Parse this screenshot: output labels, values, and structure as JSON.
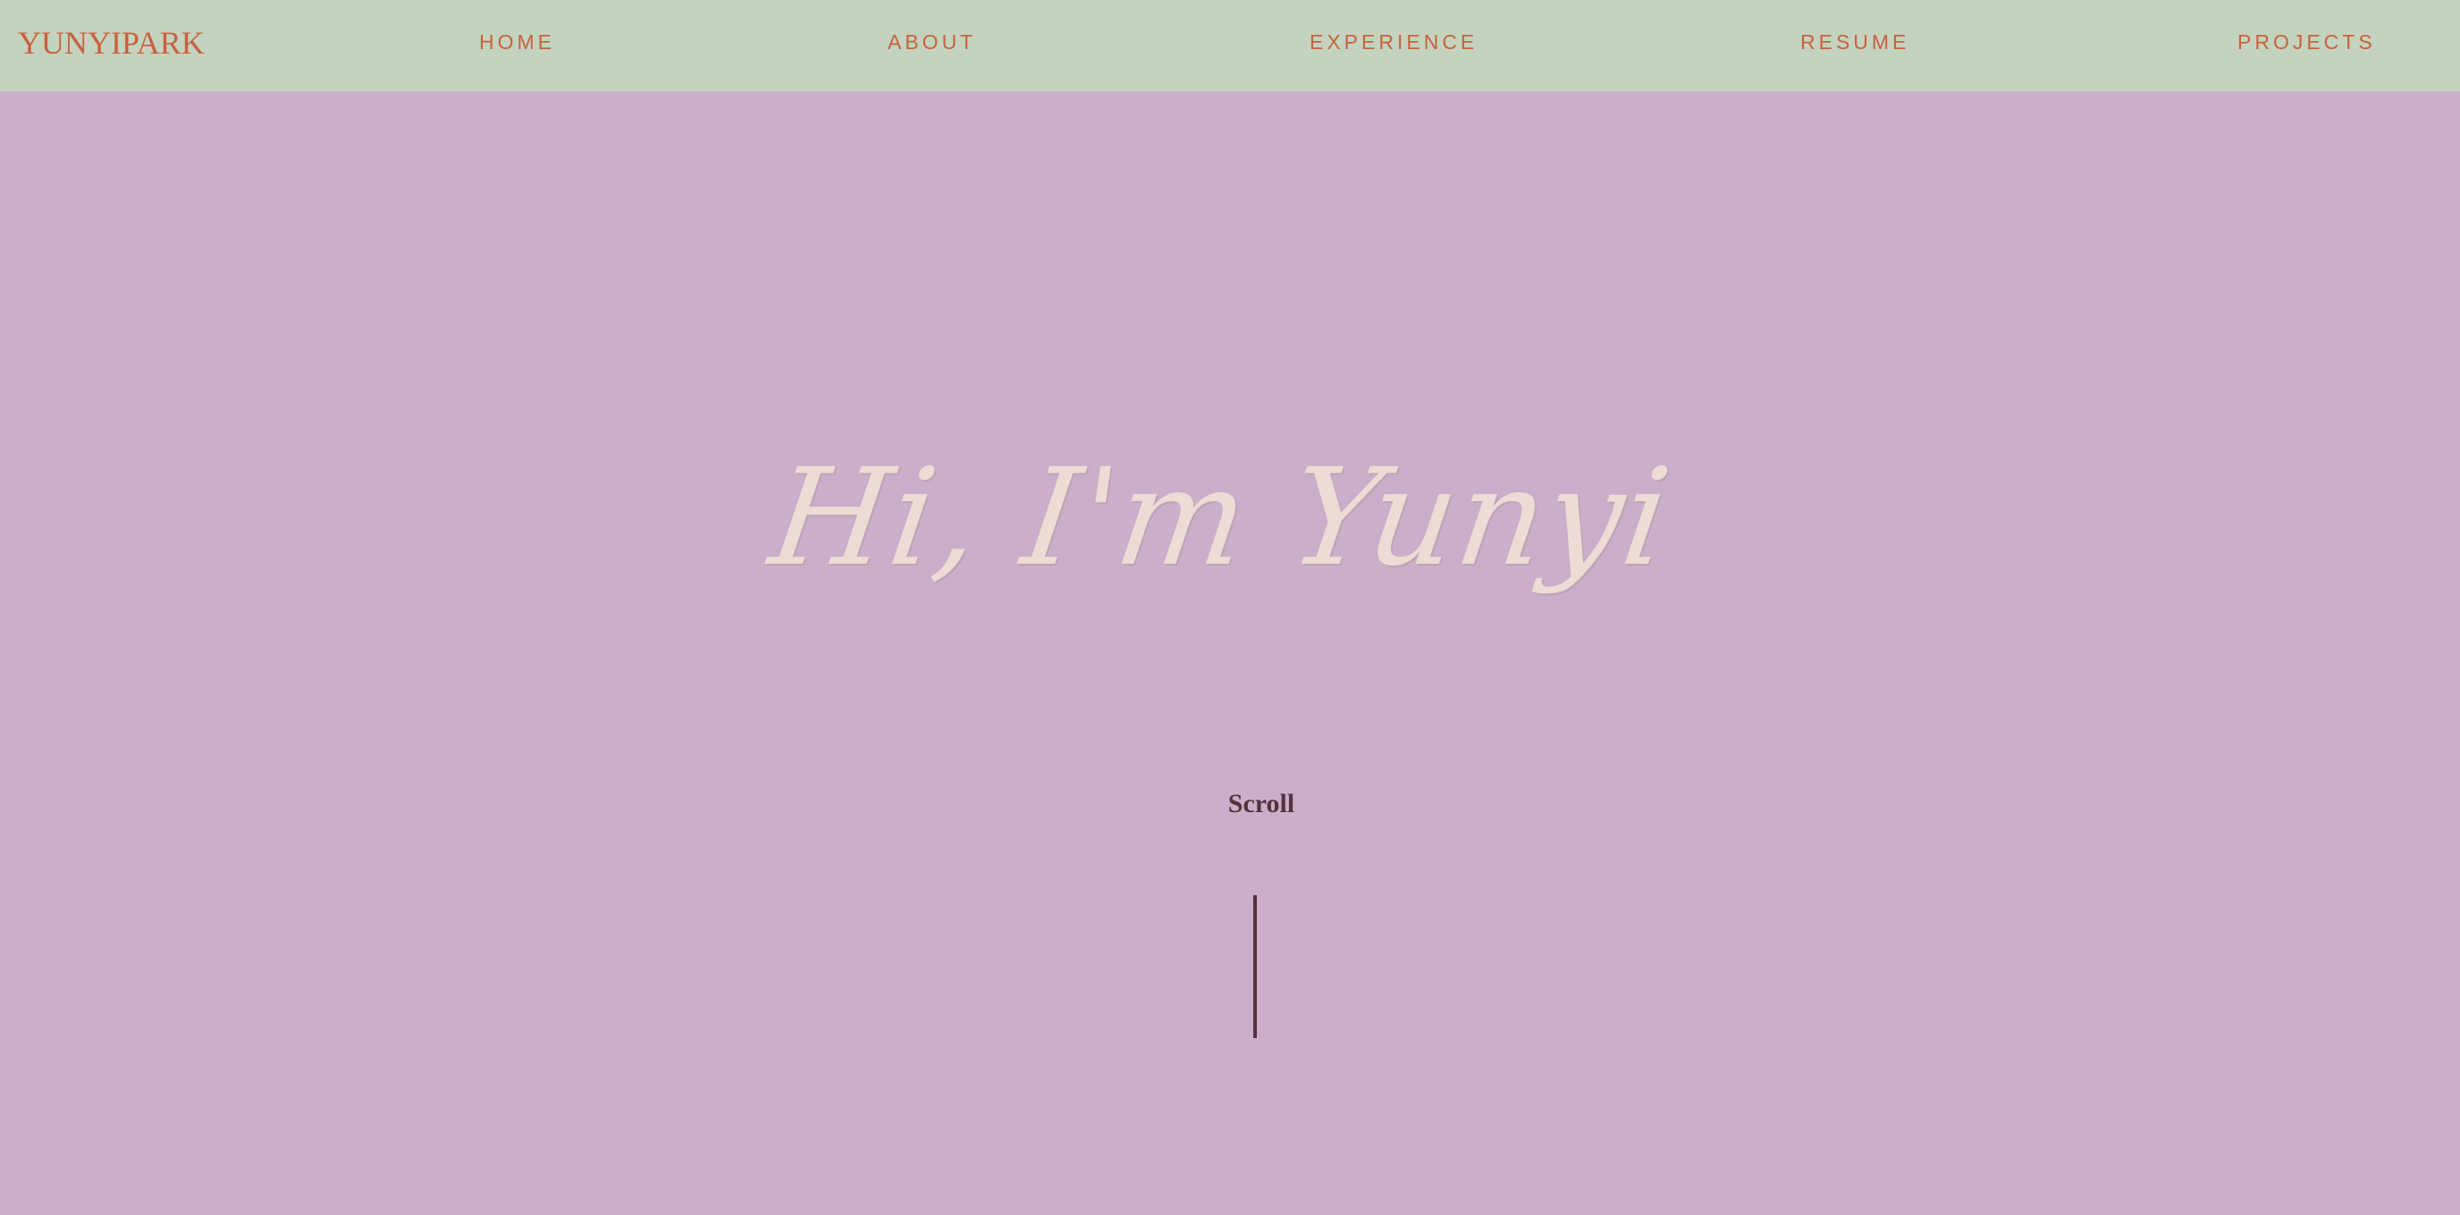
{
  "nav": {
    "brand": "YUNYIPARK",
    "links": [
      "HOME",
      "ABOUT",
      "EXPERIENCE",
      "RESUME",
      "PROJECTS"
    ]
  },
  "hero": {
    "greeting": "Hi, I'm Yunyi"
  },
  "scroll": {
    "label": "Scroll"
  },
  "colors": {
    "navbar_background": "#c4d3bd",
    "page_background": "#cbaec9",
    "accent": "#c8613f",
    "heading_text": "#eddcd5",
    "scroll_text": "#54323e"
  }
}
